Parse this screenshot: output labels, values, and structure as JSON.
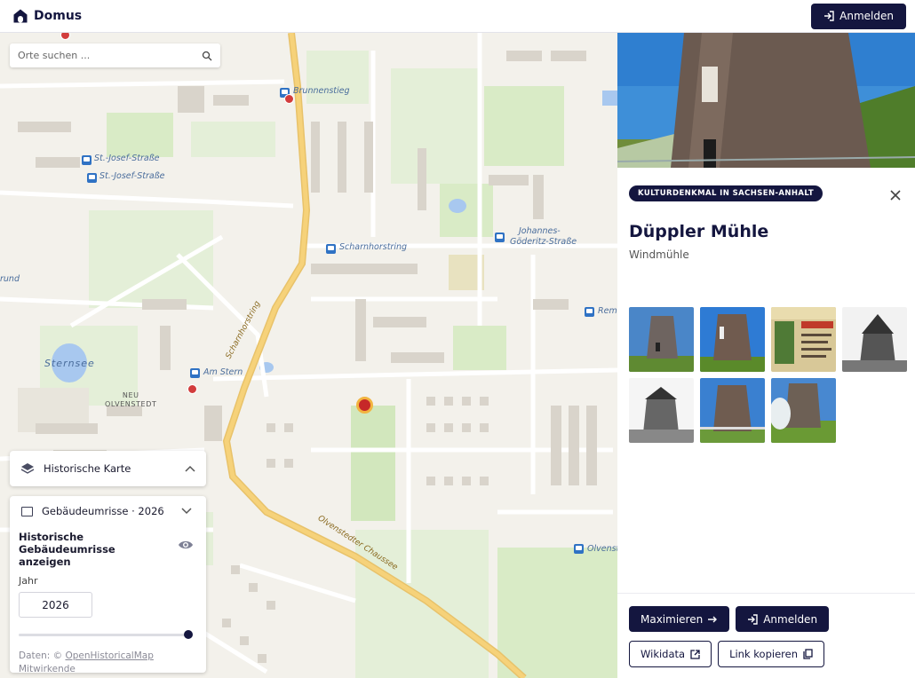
{
  "header": {
    "brand": "Domus",
    "login_label": "Anmelden"
  },
  "map": {
    "search": {
      "placeholder": "Orte suchen ..."
    },
    "labels": {
      "brunnenstieg": "Brunnenstieg",
      "st_josef_1": "St.-Josef-Straße",
      "st_josef_2": "St.-Josef-Straße",
      "scharnhorstring_stop": "Scharnhorstring",
      "johannes_1": "Johannes-",
      "johannes_2": "Göderitz-Straße",
      "am_stern": "Am Stern",
      "sternsee": "Sternsee",
      "neu_1": "NEU",
      "neu_2": "OLVENSTEDT",
      "scharnhorstring_road": "Scharnhorstring",
      "olvenstedter": "Olvenstedter Chaussee",
      "grund": "rund",
      "remi": "Remi",
      "olvenst": "Olvenst"
    },
    "layer_panel": {
      "historic_map_label": "Historische Karte",
      "building_layer_label": "Gebäudeumrisse · 2026",
      "show_historic_label": "Historische Gebäudeumrisse anzeigen",
      "year_label": "Jahr",
      "year_value": "2026",
      "year_slider_fraction": 1.0,
      "attribution_prefix": "Daten: ©",
      "attribution_link": "OpenHistoricalMap",
      "attribution_suffix": "Mitwirkende"
    }
  },
  "detail": {
    "badge": "KULTURDENKMAL IN SACHSEN-ANHALT",
    "title": "Düppler Mühle",
    "subtitle": "Windmühle",
    "thumbnail_count": 7,
    "buttons": {
      "maximize": "Maximieren",
      "login": "Anmelden",
      "wikidata": "Wikidata",
      "copy_link": "Link kopieren"
    }
  },
  "colors": {
    "primary": "#14163f",
    "poi": "#d23c3c",
    "road_major": "#f6d27a",
    "map_bg": "#f3f1eb",
    "green": "#d9ebc6",
    "water": "#a8c8ef"
  }
}
